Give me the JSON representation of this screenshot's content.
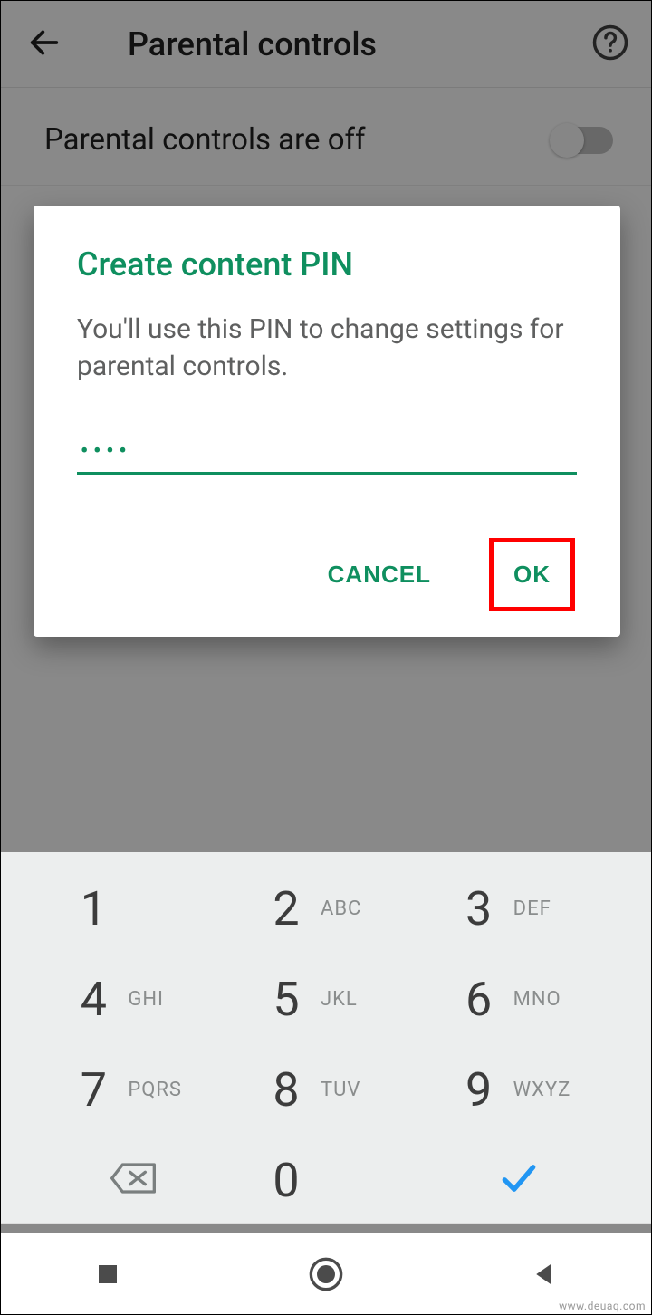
{
  "header": {
    "title": "Parental controls"
  },
  "toggle": {
    "label": "Parental controls are off",
    "on": false
  },
  "dialog": {
    "title": "Create content PIN",
    "body": "You'll use this PIN to change settings for parental controls.",
    "pin_mask": "••••",
    "cancel_label": "CANCEL",
    "ok_label": "OK"
  },
  "keypad": {
    "keys": [
      {
        "digit": "1",
        "letters": ""
      },
      {
        "digit": "2",
        "letters": "ABC"
      },
      {
        "digit": "3",
        "letters": "DEF"
      },
      {
        "digit": "4",
        "letters": "GHI"
      },
      {
        "digit": "5",
        "letters": "JKL"
      },
      {
        "digit": "6",
        "letters": "MNO"
      },
      {
        "digit": "7",
        "letters": "PQRS"
      },
      {
        "digit": "8",
        "letters": "TUV"
      },
      {
        "digit": "9",
        "letters": "WXYZ"
      },
      {
        "digit": "",
        "letters": "",
        "action": "backspace"
      },
      {
        "digit": "0",
        "letters": ""
      },
      {
        "digit": "",
        "letters": "",
        "action": "confirm"
      }
    ]
  },
  "watermark": "www.deuaq.com"
}
